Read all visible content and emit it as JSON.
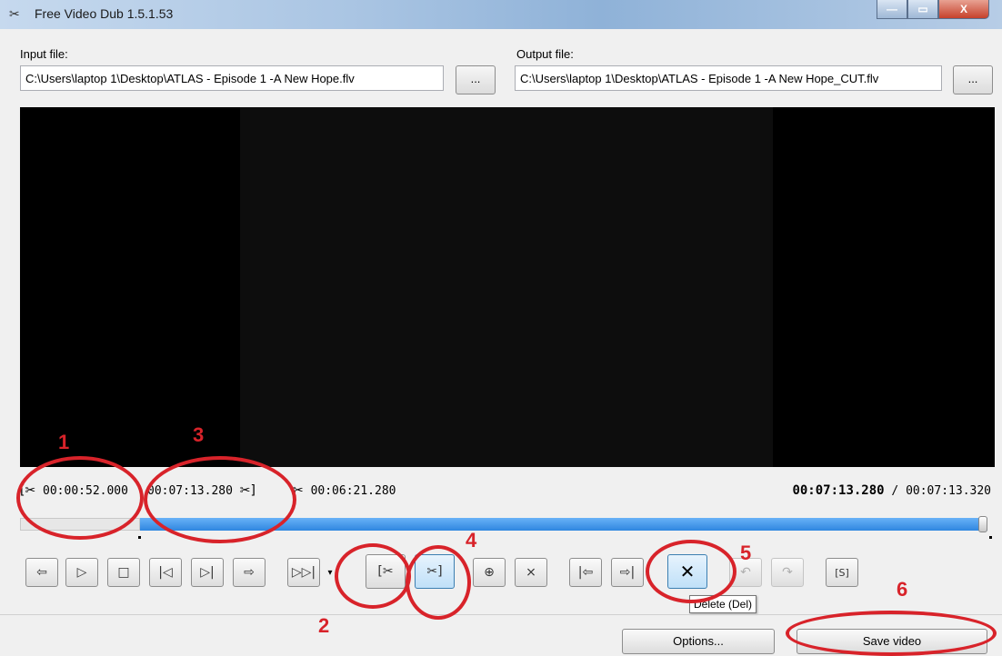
{
  "window": {
    "title": "Free Video Dub 1.5.1.53",
    "app_icon": "scissors-icon",
    "controls": {
      "minimize": "—",
      "maximize": "▭",
      "close": "X"
    }
  },
  "input": {
    "label": "Input file:",
    "value": "C:\\Users\\laptop 1\\Desktop\\ATLAS - Episode 1 -A New Hope.flv",
    "browse_label": "..."
  },
  "output": {
    "label": "Output file:",
    "value": "C:\\Users\\laptop 1\\Desktop\\ATLAS - Episode 1 -A New Hope_CUT.flv",
    "browse_label": "..."
  },
  "times": {
    "start_icon": "[✂",
    "start": "00:00:52.000",
    "end": "00:07:13.280",
    "end_icon": "✂]",
    "duration_icon": "✂",
    "duration": "00:06:21.280",
    "current": "00:07:13.280",
    "total": "/ 00:07:13.320"
  },
  "timeline": {
    "selection_start_fraction": 0.12,
    "position_fraction": 0.999
  },
  "toolbar": {
    "prev_frame": "⇦",
    "play": "▷",
    "stop": "□",
    "to_start": "|◁",
    "to_end": "▷|",
    "next_frame": "⇨",
    "skip": "▷▷|",
    "dropdown": "▾",
    "mark_start": "[✂",
    "mark_end": "✂]",
    "split": "⊕",
    "trim": "⨯",
    "go_sel_start": "|⇦",
    "go_sel_end": "⇨|",
    "delete": "✕",
    "undo": "↶",
    "redo": "↷",
    "screenshot": "[S]",
    "tooltip": "Delete (Del)"
  },
  "actions": {
    "options": "Options...",
    "save": "Save video"
  },
  "annotations": {
    "n1": "1",
    "n2": "2",
    "n3": "3",
    "n4": "4",
    "n5": "5",
    "n6": "6",
    "color": "#d8232a"
  }
}
